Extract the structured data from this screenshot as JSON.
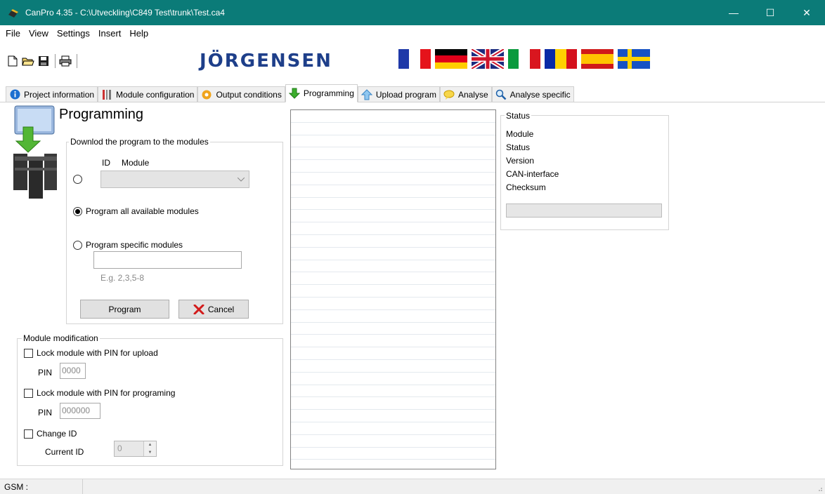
{
  "window": {
    "title": "CanPro 4.35 - C:\\Utveckling\\C849 Test\\trunk\\Test.ca4",
    "minimize": "—",
    "maximize": "☐",
    "close": "✕"
  },
  "menu": [
    "File",
    "View",
    "Settings",
    "Insert",
    "Help"
  ],
  "toolbar": {
    "icons": [
      "new-file-icon",
      "open-folder-icon",
      "save-disk-icon",
      "print-icon"
    ],
    "brand": "JÖRGENSEN",
    "flags": [
      "france",
      "germany",
      "united-kingdom",
      "italy",
      "romania",
      "spain",
      "sweden"
    ]
  },
  "tabs": [
    {
      "label": "Project information",
      "icon": "info-icon"
    },
    {
      "label": "Module configuration",
      "icon": "tools-icon"
    },
    {
      "label": "Output conditions",
      "icon": "gear-icon"
    },
    {
      "label": "Programming",
      "icon": "download-arrow-icon",
      "active": true
    },
    {
      "label": "Upload program",
      "icon": "upload-arrow-icon"
    },
    {
      "label": "Analyse",
      "icon": "analyse-icon"
    },
    {
      "label": "Analyse specific",
      "icon": "magnifier-icon"
    }
  ],
  "programming": {
    "title": "Programming",
    "download_group": {
      "legend": "Downlod the program to the modules",
      "id_label": "ID",
      "module_label": "Module",
      "all_label": "Program all available modules",
      "specific_label": "Program specific modules",
      "specific_value": "",
      "example": "E.g. 2,3,5-8",
      "program_button": "Program",
      "cancel_button": "Cancel",
      "selected_option": "all"
    },
    "modification_group": {
      "legend": "Module modification",
      "lock_upload_label": "Lock module with PIN for upload",
      "lock_upload_checked": false,
      "pin_label": "PIN",
      "pin_upload_value": "0000",
      "lock_prog_label": "Lock module with PIN for programing",
      "lock_prog_checked": false,
      "pin_prog_value": "000000",
      "change_id_label": "Change ID",
      "change_id_checked": false,
      "current_id_label": "Current ID",
      "current_id_value": "0"
    },
    "status_group": {
      "legend": "Status",
      "lines": [
        "Module",
        "Status",
        "Version",
        "CAN-interface",
        "Checksum"
      ],
      "progress": 0
    }
  },
  "statusbar": {
    "gsm": "GSM :"
  }
}
